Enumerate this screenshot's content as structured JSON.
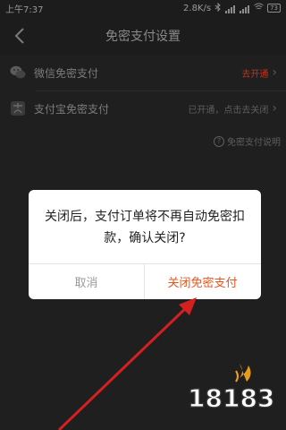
{
  "status_bar": {
    "time": "上午7:37",
    "network_speed": "2.8K/s",
    "battery": "73"
  },
  "header": {
    "title": "免密支付设置"
  },
  "rows": [
    {
      "label": "微信免密支付",
      "status": "去开通",
      "status_color": "#c0341c"
    },
    {
      "label": "支付宝免密支付",
      "status": "已开通，点击去关闭",
      "status_color": "#5e5e5e"
    }
  ],
  "help_link": "免密支付说明",
  "dialog": {
    "message": "关闭后，支付订单将不再自动免密扣款，确认关闭?",
    "cancel_label": "取消",
    "confirm_label": "关闭免密支付"
  },
  "watermark": {
    "text": "18183"
  },
  "colors": {
    "accent": "#e8541e",
    "annotation_arrow": "#d42020"
  }
}
